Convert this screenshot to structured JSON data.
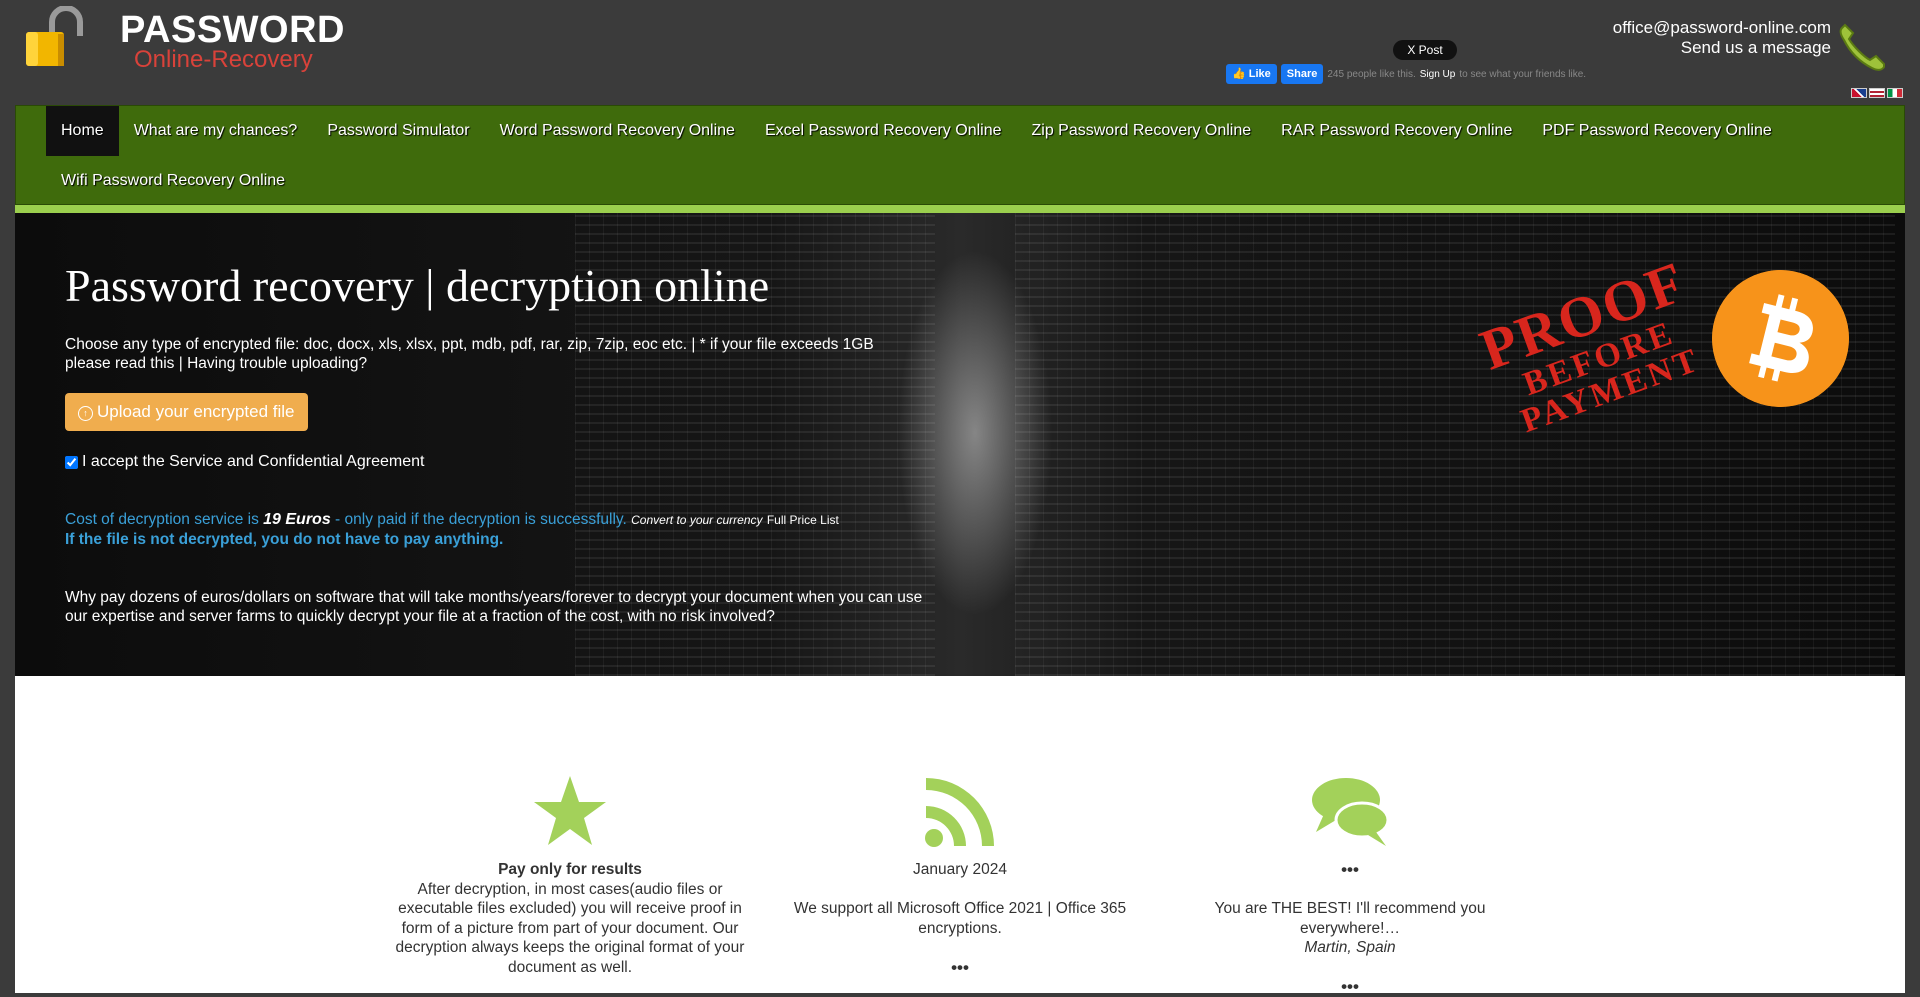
{
  "header": {
    "logo_title": "PASSWORD",
    "logo_subtitle": "Online-Recovery",
    "x_post": "X Post",
    "fb_like": "Like",
    "fb_share": "Share",
    "fb_count_text": "245 people like this.",
    "fb_signup": "Sign Up",
    "fb_tail": "to see what your friends like.",
    "email": "office@password-online.com",
    "message_link": "Send us a message"
  },
  "nav": {
    "row1": [
      "Home",
      "What are my chances?",
      "Password Simulator",
      "Word Password Recovery Online",
      "Excel Password Recovery Online",
      "Zip Password Recovery Online",
      "RAR Password Recovery Online",
      "PDF Password Recovery Online"
    ],
    "row2": [
      "Wifi Password Recovery Online"
    ],
    "active": "Home"
  },
  "hero": {
    "title": "Password recovery | decryption online",
    "intro_line1": "Choose any type of encrypted file: doc, docx, xls, xlsx, ppt, mdb, pdf, rar, zip, 7zip, eoc etc.   |  * if your file exceeds 1GB",
    "intro_line2": "please read this   |  Having trouble uploading?",
    "upload_button": "Upload your encrypted file",
    "accept_label": "I accept the Service and Confidential Agreement",
    "cost_prefix": "Cost of decryption service is ",
    "cost_amount": "19 Euros",
    "cost_suffix": " - only paid if the decryption is successfully.",
    "convert_link": "Convert to your currency",
    "price_list_link": "Full Price List",
    "no_pay": "If the file is not decrypted, you do not have to pay anything.",
    "why_text": "Why pay dozens of euros/dollars on software that will take months/years/forever to decrypt your document when you can use our expertise and server farms to quickly decrypt your file at a fraction of the cost, with no risk involved?",
    "stamp_line1": "PROOF",
    "stamp_line2": "BEFORE",
    "stamp_line3": "PAYMENT"
  },
  "features": [
    {
      "icon": "star-icon",
      "heading": "Pay only for results",
      "text": "After decryption, in most cases(audio files or executable files excluded) you will receive proof in form of a picture from part of your document. Our decryption always keeps the original format of your document as well."
    },
    {
      "icon": "rss-icon",
      "heading": "January 2024",
      "text": "We support all Microsoft Office 2021 | Office 365 encryptions.",
      "more": "•••"
    },
    {
      "icon": "comments-icon",
      "heading": "•••",
      "text": "You are THE BEST! I'll recommend you everywhere!…",
      "author": "Martin, Spain",
      "more": "•••"
    }
  ],
  "colors": {
    "nav_bg": "#3f6b0c",
    "nav_stripe": "#9bcf4e",
    "accent_orange": "#f0ad4e",
    "link_blue": "#3aa0d8",
    "icon_green": "#a3d15a",
    "logo_red": "#d9423a",
    "bitcoin": "#f7931a"
  }
}
